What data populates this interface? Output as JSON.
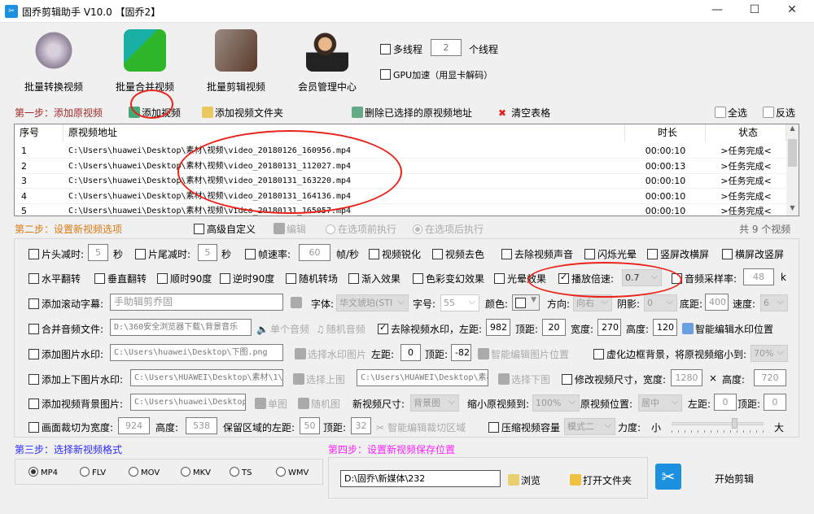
{
  "window": {
    "title": "固乔剪辑助手 V10.0 【固乔2】",
    "minimize": "—",
    "maximize": "☐",
    "close": "✕"
  },
  "toolbar": {
    "items": [
      {
        "label": "批量转换视频"
      },
      {
        "label": "批量合并视频"
      },
      {
        "label": "批量剪辑视频"
      },
      {
        "label": "会员管理中心"
      }
    ],
    "multithread_label": "多线程",
    "threads": "2",
    "threads_unit": "个线程",
    "gpu_label": "GPU加速（用显卡解码）"
  },
  "step1": {
    "label": "第一步：添加原视频",
    "add_video": "添加视频",
    "add_folder": "添加视频文件夹",
    "delete_selected": "删除已选择的原视频地址",
    "clear_table": "清空表格",
    "select_all": "全选",
    "invert": "反选"
  },
  "table": {
    "headers": [
      "序号",
      "原视频地址",
      "时长",
      "状态"
    ],
    "rows": [
      {
        "no": "1",
        "path": "C:\\Users\\huawei\\Desktop\\素材\\视频\\video_20180126_160956.mp4",
        "duration": "00:00:10",
        "status": ">任务完成<"
      },
      {
        "no": "2",
        "path": "C:\\Users\\huawei\\Desktop\\素材\\视频\\video_20180131_112027.mp4",
        "duration": "00:00:13",
        "status": ">任务完成<"
      },
      {
        "no": "3",
        "path": "C:\\Users\\huawei\\Desktop\\素材\\视频\\video_20180131_163220.mp4",
        "duration": "00:00:10",
        "status": ">任务完成<"
      },
      {
        "no": "4",
        "path": "C:\\Users\\huawei\\Desktop\\素材\\视频\\video_20180131_164136.mp4",
        "duration": "00:00:10",
        "status": ">任务完成<"
      },
      {
        "no": "5",
        "path": "C:\\Users\\huawei\\Desktop\\素材\\视频\\video_20180131_165057.mp4",
        "duration": "00:00:10",
        "status": ">任务完成<"
      }
    ]
  },
  "step2": {
    "label": "第二步：设置新视频选项",
    "advanced": "高级自定义",
    "edit": "编辑",
    "before": "在选项前执行",
    "after": "在选项后执行",
    "count": "共 9 个视频"
  },
  "opts": {
    "r1": {
      "head_cut": "片头减时:",
      "head_val": "5",
      "sec1": "秒",
      "tail_cut": "片尾减时:",
      "tail_val": "5",
      "sec2": "秒",
      "fps": "帧速率:",
      "fps_val": "60",
      "fps_unit": "帧/秒",
      "sharpen": "视频锐化",
      "decolor": "视频去色",
      "mute": "去除视频声音",
      "flash": "闪烁光晕",
      "v2h": "竖屏改横屏",
      "h2v": "横屏改竖屏"
    },
    "r2": {
      "hflip": "水平翻转",
      "vflip": "垂直翻转",
      "cw90": "顺时90度",
      "ccw90": "逆时90度",
      "rand_trans": "随机转场",
      "fadein": "渐入效果",
      "color_fx": "色彩变幻效果",
      "halo": "光晕效果",
      "speed": "播放倍速:",
      "speed_val": "0.7",
      "sample": "音频采样率:",
      "sample_val": "48",
      "sample_unit": "k"
    },
    "r3": {
      "scroll": "添加滚动字幕:",
      "scroll_text": "手助辑剪乔固",
      "font": "字体:",
      "font_val": "华文琥珀(STI",
      "size": "字号:",
      "size_val": "55",
      "color": "颜色:",
      "dir": "方向:",
      "dir_val": "向右",
      "shadow": "阴影:",
      "shadow_val": "0",
      "bottom": "底距:",
      "bottom_val": "400",
      "speed": "速度:",
      "speed_val": "6"
    },
    "r4": {
      "audio": "合并音频文件:",
      "audio_path": "D:\\360安全浏览器下载\\背景音乐",
      "single": "单个音频",
      "random": "随机音频",
      "rm_wm": "去除视频水印，左距:",
      "left": "982",
      "top_l": "顶距:",
      "top": "20",
      "w_l": "宽度:",
      "w": "270",
      "h_l": "高度:",
      "h": "120",
      "smart": "智能编辑水印位置"
    },
    "r5": {
      "img_wm": "添加图片水印:",
      "img_path": "C:\\Users\\huawei\\Desktop\\下图.png",
      "choose": "选择水印图片",
      "left_l": "左距:",
      "left": "0",
      "top_l": "顶距:",
      "top": "-82",
      "smart": "智能编辑图片位置",
      "blur": "虚化边框背景，将原视频缩小到:",
      "blur_val": "70%"
    },
    "r6": {
      "tb_wm": "添加上下图片水印:",
      "top_path": "C:\\Users\\HUAWEI\\Desktop\\素材\\1\\El",
      "choose_top": "选择上图",
      "bottom_path": "C:\\Users\\HUAWEI\\Desktop\\素材",
      "choose_bottom": "选择下图",
      "resize": "修改视频尺寸，宽度:",
      "w": "1280",
      "x": "×",
      "h_l": "高度:",
      "h": "720"
    },
    "r7": {
      "bg": "添加视频背景图片:",
      "bg_path": "C:\\Users\\huawei\\Desktop\\",
      "single": "单图",
      "random": "随机图",
      "size_l": "新视频尺寸:",
      "size_val": "背景图",
      "shrink_l": "缩小原视频到:",
      "shrink_val": "100%",
      "pos_l": "原视频位置:",
      "pos_val": "居中",
      "left_l": "左距:",
      "left": "0",
      "top_l": "顶距:",
      "top": "0"
    },
    "r8": {
      "crop": "画面裁切为宽度:",
      "w": "924",
      "h_l": "高度:",
      "h": "538",
      "left_l": "保留区域的左距:",
      "left": "50",
      "top_l": "顶距:",
      "top": "32",
      "smart": "智能编辑裁切区域",
      "compress": "压缩视频容量",
      "mode": "模式二",
      "force": "力度:",
      "small": "小",
      "big": "大",
      "force_value": 0.7
    }
  },
  "step3": {
    "label": "第三步：选择新视频格式",
    "formats": [
      "MP4",
      "FLV",
      "MOV",
      "MKV",
      "TS",
      "WMV"
    ],
    "selected": "MP4"
  },
  "step4": {
    "label": "第四步：设置新视频保存位置",
    "path": "D:\\固乔\\新媒体\\232",
    "browse": "浏览",
    "open_folder": "打开文件夹",
    "start": "开始剪辑"
  },
  "colors": {
    "step1": "#a0282a",
    "step2": "#d97a14",
    "step3": "#2b2bff",
    "step4": "#ff20ff",
    "annotation": "#e8231b"
  }
}
